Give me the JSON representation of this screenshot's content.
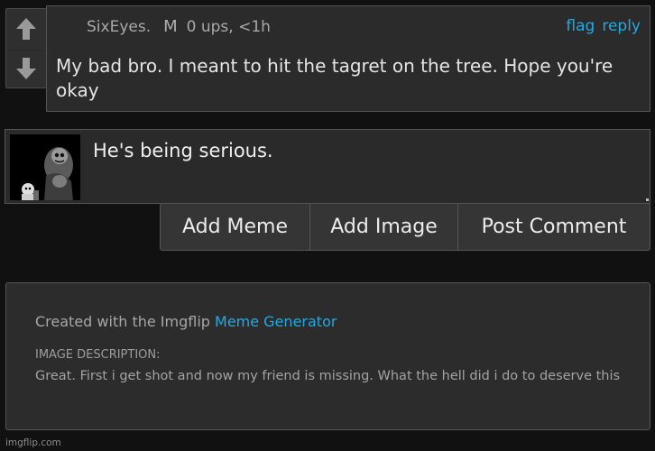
{
  "comment": {
    "username": "SixEyes.",
    "mod_badge": "M",
    "meta": "0 ups, <1h",
    "flag_label": "flag",
    "reply_label": "reply",
    "text": "My bad bro. I meant to hit the tagret on the tree. Hope you're okay"
  },
  "reply": {
    "text": "He's being serious."
  },
  "actions": {
    "add_meme": "Add Meme",
    "add_image": "Add Image",
    "post_comment": "Post Comment"
  },
  "info": {
    "created_prefix": "Created with the Imgflip ",
    "created_link": "Meme Generator",
    "desc_label": "IMAGE DESCRIPTION:",
    "desc_text": "Great. First i get shot and now my friend is missing. What the hell did i do to deserve this"
  },
  "watermark": "imgflip.com",
  "colors": {
    "link": "#23a9e1",
    "background": "#111111",
    "panel": "#2b2b2b"
  },
  "icons": [
    "upvote-arrow-icon",
    "downvote-arrow-icon"
  ]
}
